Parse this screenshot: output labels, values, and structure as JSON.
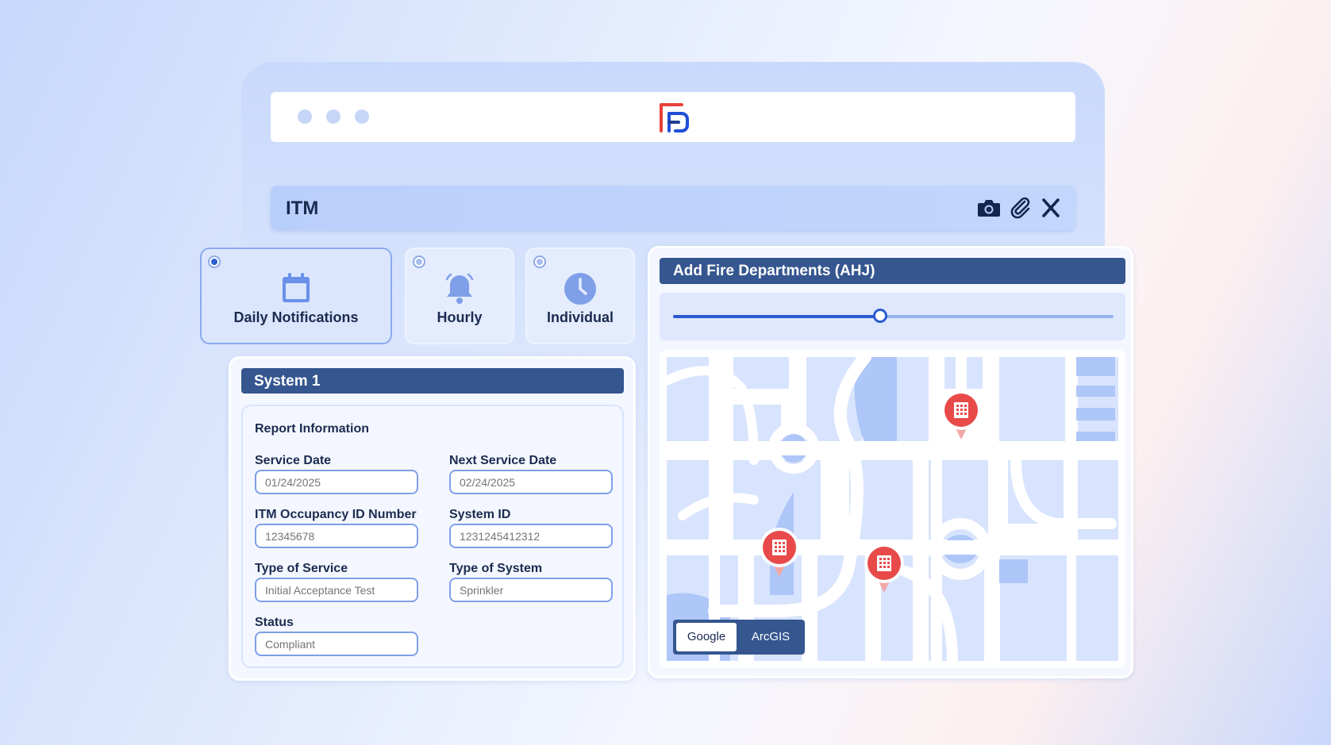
{
  "itm_bar": {
    "title": "ITM",
    "icons": [
      "camera-icon",
      "paperclip-icon",
      "close-icon"
    ]
  },
  "notification_options": [
    {
      "label": "Daily Notifications",
      "icon": "calendar-icon",
      "selected": true
    },
    {
      "label": "Hourly",
      "icon": "bell-icon",
      "selected": false
    },
    {
      "label": "Individual",
      "icon": "clock-icon",
      "selected": false
    }
  ],
  "system_panel": {
    "header": "System 1",
    "section_title": "Report Information",
    "fields": {
      "service_date": {
        "label": "Service Date",
        "value": "01/24/2025"
      },
      "next_service_date": {
        "label": "Next Service Date",
        "value": "02/24/2025"
      },
      "occupancy_id": {
        "label": "ITM Occupancy ID Number",
        "value": "12345678"
      },
      "system_id": {
        "label": "System ID",
        "value": "1231245412312"
      },
      "type_of_service": {
        "label": "Type of Service",
        "value": "Initial Acceptance Test"
      },
      "type_of_system": {
        "label": "Type of System",
        "value": "Sprinkler"
      },
      "status": {
        "label": "Status",
        "value": "Compliant"
      }
    }
  },
  "ahj_panel": {
    "header": "Add Fire Departments (AHJ)",
    "slider_value_fraction": 0.47,
    "map_toggle": {
      "active": "Google",
      "inactive": "ArcGIS"
    },
    "map_pin_icon": "building-icon",
    "map_pin_count": 3
  },
  "colors": {
    "header_bg": "#35568f",
    "accent_blue": "#2c5ad0",
    "pin_red": "#e84a4a",
    "logo_red": "#e8403a",
    "logo_blue": "#1f4fd6"
  }
}
